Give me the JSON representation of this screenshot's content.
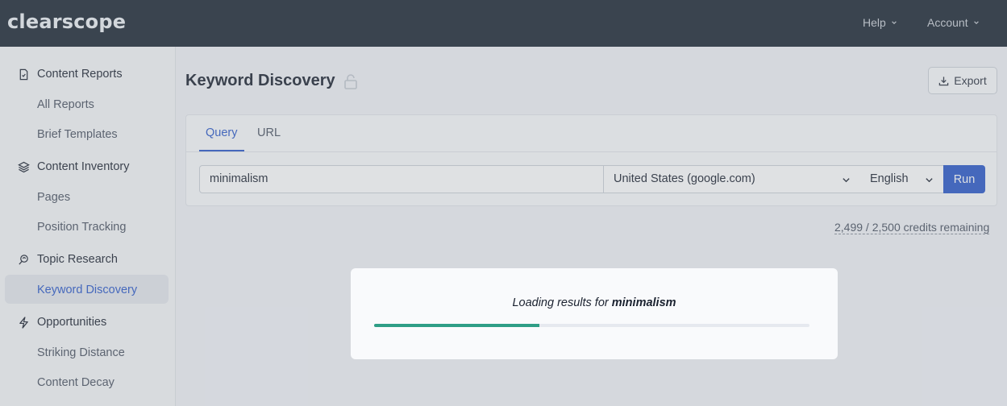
{
  "header": {
    "logo": "clearscope",
    "help_label": "Help",
    "account_label": "Account"
  },
  "sidebar": {
    "groups": [
      {
        "label": "Content Reports",
        "icon": "document-icon",
        "items": [
          "All Reports",
          "Brief Templates"
        ]
      },
      {
        "label": "Content Inventory",
        "icon": "layers-icon",
        "items": [
          "Pages",
          "Position Tracking"
        ]
      },
      {
        "label": "Topic Research",
        "icon": "research-icon",
        "items": [
          "Keyword Discovery"
        ]
      },
      {
        "label": "Opportunities",
        "icon": "lightning-icon",
        "items": [
          "Striking Distance",
          "Content Decay"
        ]
      }
    ],
    "active_item": "Keyword Discovery"
  },
  "main": {
    "title": "Keyword Discovery",
    "export_label": "Export",
    "tabs": [
      "Query",
      "URL"
    ],
    "active_tab": "Query",
    "query_value": "minimalism",
    "country_value": "United States (google.com)",
    "language_value": "English",
    "run_label": "Run",
    "credits": "2,499 / 2,500 credits remaining"
  },
  "loading_modal": {
    "prefix": "Loading results for ",
    "term": "minimalism",
    "progress": 0.38
  },
  "colors": {
    "accent": "#2a58c9",
    "progress": "#2f9e86",
    "topbar": "#1b2633"
  }
}
